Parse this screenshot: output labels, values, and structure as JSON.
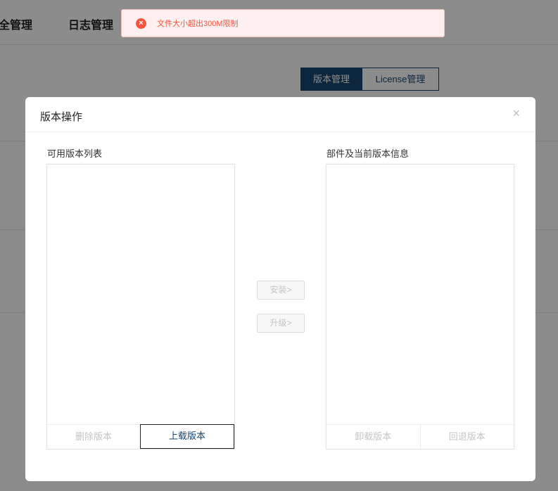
{
  "nav": {
    "items": [
      "全管理",
      "日志管理"
    ]
  },
  "segmented": {
    "active_label": "版本管理",
    "inactive_label": "License管理"
  },
  "toast": {
    "icon": "error-circle-icon",
    "message": "文件大小超出300M限制",
    "color": "#f5533d"
  },
  "modal": {
    "title": "版本操作",
    "close_glyph": "×",
    "left_panel": {
      "label": "可用版本列表",
      "buttons": [
        "删除版本",
        "上载版本"
      ]
    },
    "right_panel": {
      "label": "部件及当前版本信息",
      "buttons": [
        "卸载版本",
        "回退版本"
      ]
    },
    "actions": {
      "install_label": "安装>",
      "upgrade_label": "升级>"
    }
  },
  "colors": {
    "brand": "#16466f",
    "error": "#f5533d"
  }
}
